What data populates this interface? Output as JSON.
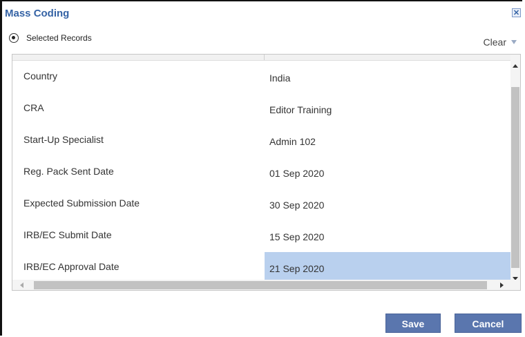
{
  "dialog": {
    "title": "Mass Coding",
    "close_icon": "close-icon"
  },
  "scope": {
    "selected_label": "Selected Records",
    "selected": true
  },
  "clear": {
    "label": "Clear",
    "icon": "chevron-down-icon"
  },
  "fields": [
    {
      "label": "Country",
      "value": "India"
    },
    {
      "label": "CRA",
      "value": "Editor Training"
    },
    {
      "label": "Start-Up Specialist",
      "value": "Admin 102"
    },
    {
      "label": "Reg. Pack Sent Date",
      "value": "01 Sep 2020"
    },
    {
      "label": "Expected Submission Date",
      "value": "30 Sep 2020"
    },
    {
      "label": "IRB/EC Submit Date",
      "value": "15 Sep 2020"
    },
    {
      "label": "IRB/EC Approval Date",
      "value": "21 Sep 2020",
      "selected": true
    }
  ],
  "buttons": {
    "save": "Save",
    "cancel": "Cancel"
  },
  "colors": {
    "title": "#3563a5",
    "button": "#5a76ae",
    "selected_cell": "#b9d0ee"
  }
}
